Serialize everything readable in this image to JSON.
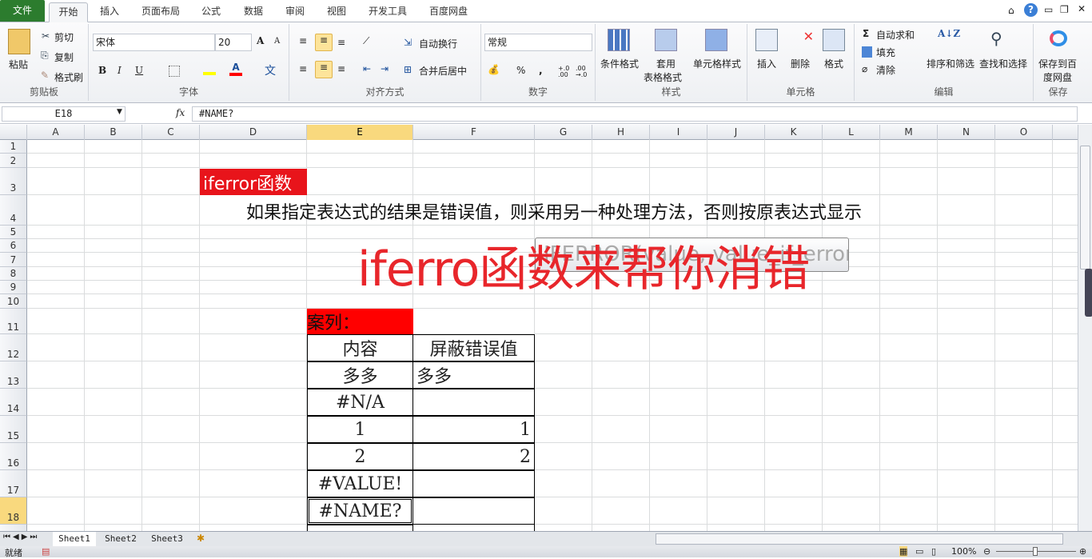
{
  "tabs": [
    "文件",
    "开始",
    "插入",
    "页面布局",
    "公式",
    "数据",
    "审阅",
    "视图",
    "开发工具",
    "百度网盘"
  ],
  "ribbon": {
    "clipboard": {
      "paste": "粘贴",
      "cut": "剪切",
      "copy": "复制",
      "painter": "格式刷",
      "label": "剪贴板"
    },
    "font": {
      "name": "宋体",
      "size": "20",
      "bold": "B",
      "italic": "I",
      "underline": "U",
      "label": "字体",
      "fill_color": "#ffff00",
      "font_color": "#ff0000"
    },
    "alignment": {
      "wrap": "自动换行",
      "merge": "合并后居中",
      "label": "对齐方式"
    },
    "number": {
      "format": "常规",
      "percent": "%",
      "comma": ",",
      "inc": "+.0 .00",
      "dec": ".00 →.0",
      "label": "数字"
    },
    "styles": {
      "cond": "条件格式",
      "table1": "套用",
      "table2": "表格格式",
      "cell": "单元格样式",
      "label": "样式"
    },
    "cells": {
      "insert": "插入",
      "delete": "删除",
      "format": "格式",
      "label": "单元格"
    },
    "editing": {
      "autosum": "自动求和",
      "fill": "填充",
      "clear": "清除",
      "sort": "排序和筛选",
      "find": "查找和选择",
      "label": "编辑"
    },
    "save": {
      "line1": "保存到百",
      "line2": "度网盘",
      "label": "保存"
    }
  },
  "formula_bar": {
    "name_box": "E18",
    "fx": "fx",
    "formula": "#NAME?"
  },
  "columns": [
    "A",
    "B",
    "C",
    "D",
    "E",
    "F",
    "G",
    "H",
    "I",
    "J",
    "K",
    "L",
    "M",
    "N",
    "O"
  ],
  "rows": [
    "1",
    "2",
    "3",
    "4",
    "5",
    "6",
    "7",
    "8",
    "9",
    "10",
    "11",
    "12",
    "13",
    "14",
    "15",
    "16",
    "17",
    "18"
  ],
  "sheet": {
    "d3": "iferror函数",
    "d4": "如果指定表达式的结果是错误值，则采用另一种处理方法，否则按原表达式显示",
    "title": "iferro函数来帮你消错",
    "tooltip": "IFERROR(value, value_if_error)",
    "e11": "案列：",
    "table": [
      [
        "内容",
        "屏蔽错误值"
      ],
      [
        "多多",
        "多多"
      ],
      [
        "#N/A",
        ""
      ],
      [
        "1",
        "1"
      ],
      [
        "2",
        "2"
      ],
      [
        "#VALUE!",
        ""
      ],
      [
        "#NAME?",
        ""
      ]
    ]
  },
  "sheets": [
    "Sheet1",
    "Sheet2",
    "Sheet3"
  ],
  "status": {
    "ready": "就绪",
    "zoom": "100%"
  }
}
